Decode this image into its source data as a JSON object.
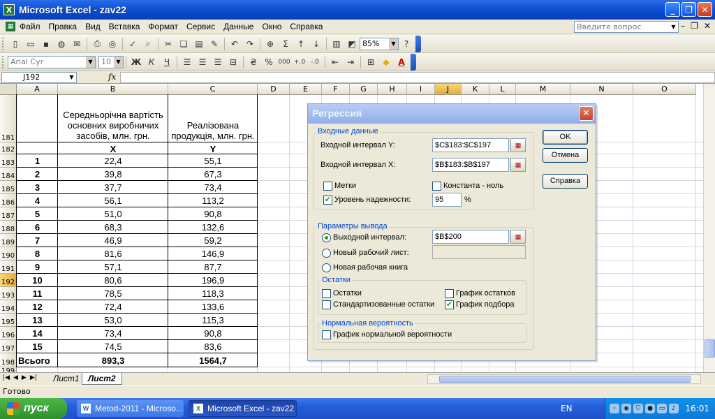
{
  "window": {
    "title": "Microsoft Excel - zav22"
  },
  "menu": {
    "items": [
      "Файл",
      "Правка",
      "Вид",
      "Вставка",
      "Формат",
      "Сервис",
      "Данные",
      "Окно",
      "Справка"
    ],
    "ask_placeholder": "Введите вопрос"
  },
  "toolbar": {
    "zoom": "85%",
    "font_name": "Arial Cyr",
    "font_size": "10",
    "bold": "Ж",
    "italic": "К",
    "underline": "Ч",
    "percent": "%",
    "thousands": "000"
  },
  "formula_bar": {
    "name_box": "J192",
    "fx": "fx",
    "value": ""
  },
  "grid": {
    "columns": [
      "A",
      "B",
      "C",
      "D",
      "E",
      "F",
      "G",
      "H",
      "I",
      "J",
      "K",
      "L",
      "M",
      "N",
      "O"
    ],
    "active_column": "J",
    "active_row": "192",
    "rows": [
      "181",
      "182",
      "183",
      "184",
      "185",
      "186",
      "187",
      "188",
      "189",
      "190",
      "191",
      "192",
      "193",
      "194",
      "195",
      "196",
      "197",
      "198",
      "199"
    ],
    "header_b": "Середньорічна вартість основних виробничих засобів, млн. грн.",
    "header_c": "Реалізована продукція, млн. грн.",
    "var_x": "X",
    "var_y": "Y",
    "data": [
      {
        "n": "1",
        "x": "22,4",
        "y": "55,1"
      },
      {
        "n": "2",
        "x": "39,8",
        "y": "67,3"
      },
      {
        "n": "3",
        "x": "37,7",
        "y": "73,4"
      },
      {
        "n": "4",
        "x": "56,1",
        "y": "113,2"
      },
      {
        "n": "5",
        "x": "51,0",
        "y": "90,8"
      },
      {
        "n": "6",
        "x": "68,3",
        "y": "132,6"
      },
      {
        "n": "7",
        "x": "46,9",
        "y": "59,2"
      },
      {
        "n": "8",
        "x": "81,6",
        "y": "146,9"
      },
      {
        "n": "9",
        "x": "57,1",
        "y": "87,7"
      },
      {
        "n": "10",
        "x": "80,6",
        "y": "196,9"
      },
      {
        "n": "11",
        "x": "78,5",
        "y": "118,3"
      },
      {
        "n": "12",
        "x": "72,4",
        "y": "133,6"
      },
      {
        "n": "13",
        "x": "53,0",
        "y": "115,3"
      },
      {
        "n": "14",
        "x": "73,4",
        "y": "90,8"
      },
      {
        "n": "15",
        "x": "74,5",
        "y": "83,6"
      }
    ],
    "total_label": "Всього",
    "total_x": "893,3",
    "total_y": "1564,7"
  },
  "sheets": {
    "tab1": "Лист1",
    "tab2": "Лист2",
    "active": "Лист2"
  },
  "status": {
    "text": "Готово"
  },
  "taskbar": {
    "start": "пуск",
    "btn1": "Metod-2011 - Microso...",
    "btn2": "Microsoft Excel - zav22",
    "lang": "EN",
    "clock": "16:01"
  },
  "dialog": {
    "title": "Регрессия",
    "input_group": "Входные данные",
    "y_label": "Входной интервал Y:",
    "y_value": "$C$183:$C$197",
    "x_label": "Входной интервал X:",
    "x_value": "$B$183:$B$197",
    "labels_chk": "Метки",
    "labels_checked": false,
    "const_chk": "Константа - ноль",
    "const_checked": false,
    "conf_chk": "Уровень надежности:",
    "conf_checked": true,
    "conf_value": "95",
    "conf_unit": "%",
    "output_group": "Параметры вывода",
    "out_range": "Выходной интервал:",
    "out_range_value": "$B$200",
    "out_range_selected": true,
    "new_sheet": "Новый рабочий лист:",
    "new_sheet_value": "",
    "new_book": "Новая рабочая книга",
    "residuals_group": "Остатки",
    "residuals": "Остатки",
    "residuals_checked": false,
    "std_residuals": "Стандартизованные остатки",
    "std_residuals_checked": false,
    "resid_plot": "График остатков",
    "resid_plot_checked": false,
    "fit_plot": "График подбора",
    "fit_plot_checked": true,
    "normal_group": "Нормальная вероятность",
    "normal_plot": "График нормальной вероятности",
    "normal_plot_checked": false,
    "ok": "OK",
    "cancel": "Отмена",
    "help": "Справка",
    "close": "✕"
  }
}
